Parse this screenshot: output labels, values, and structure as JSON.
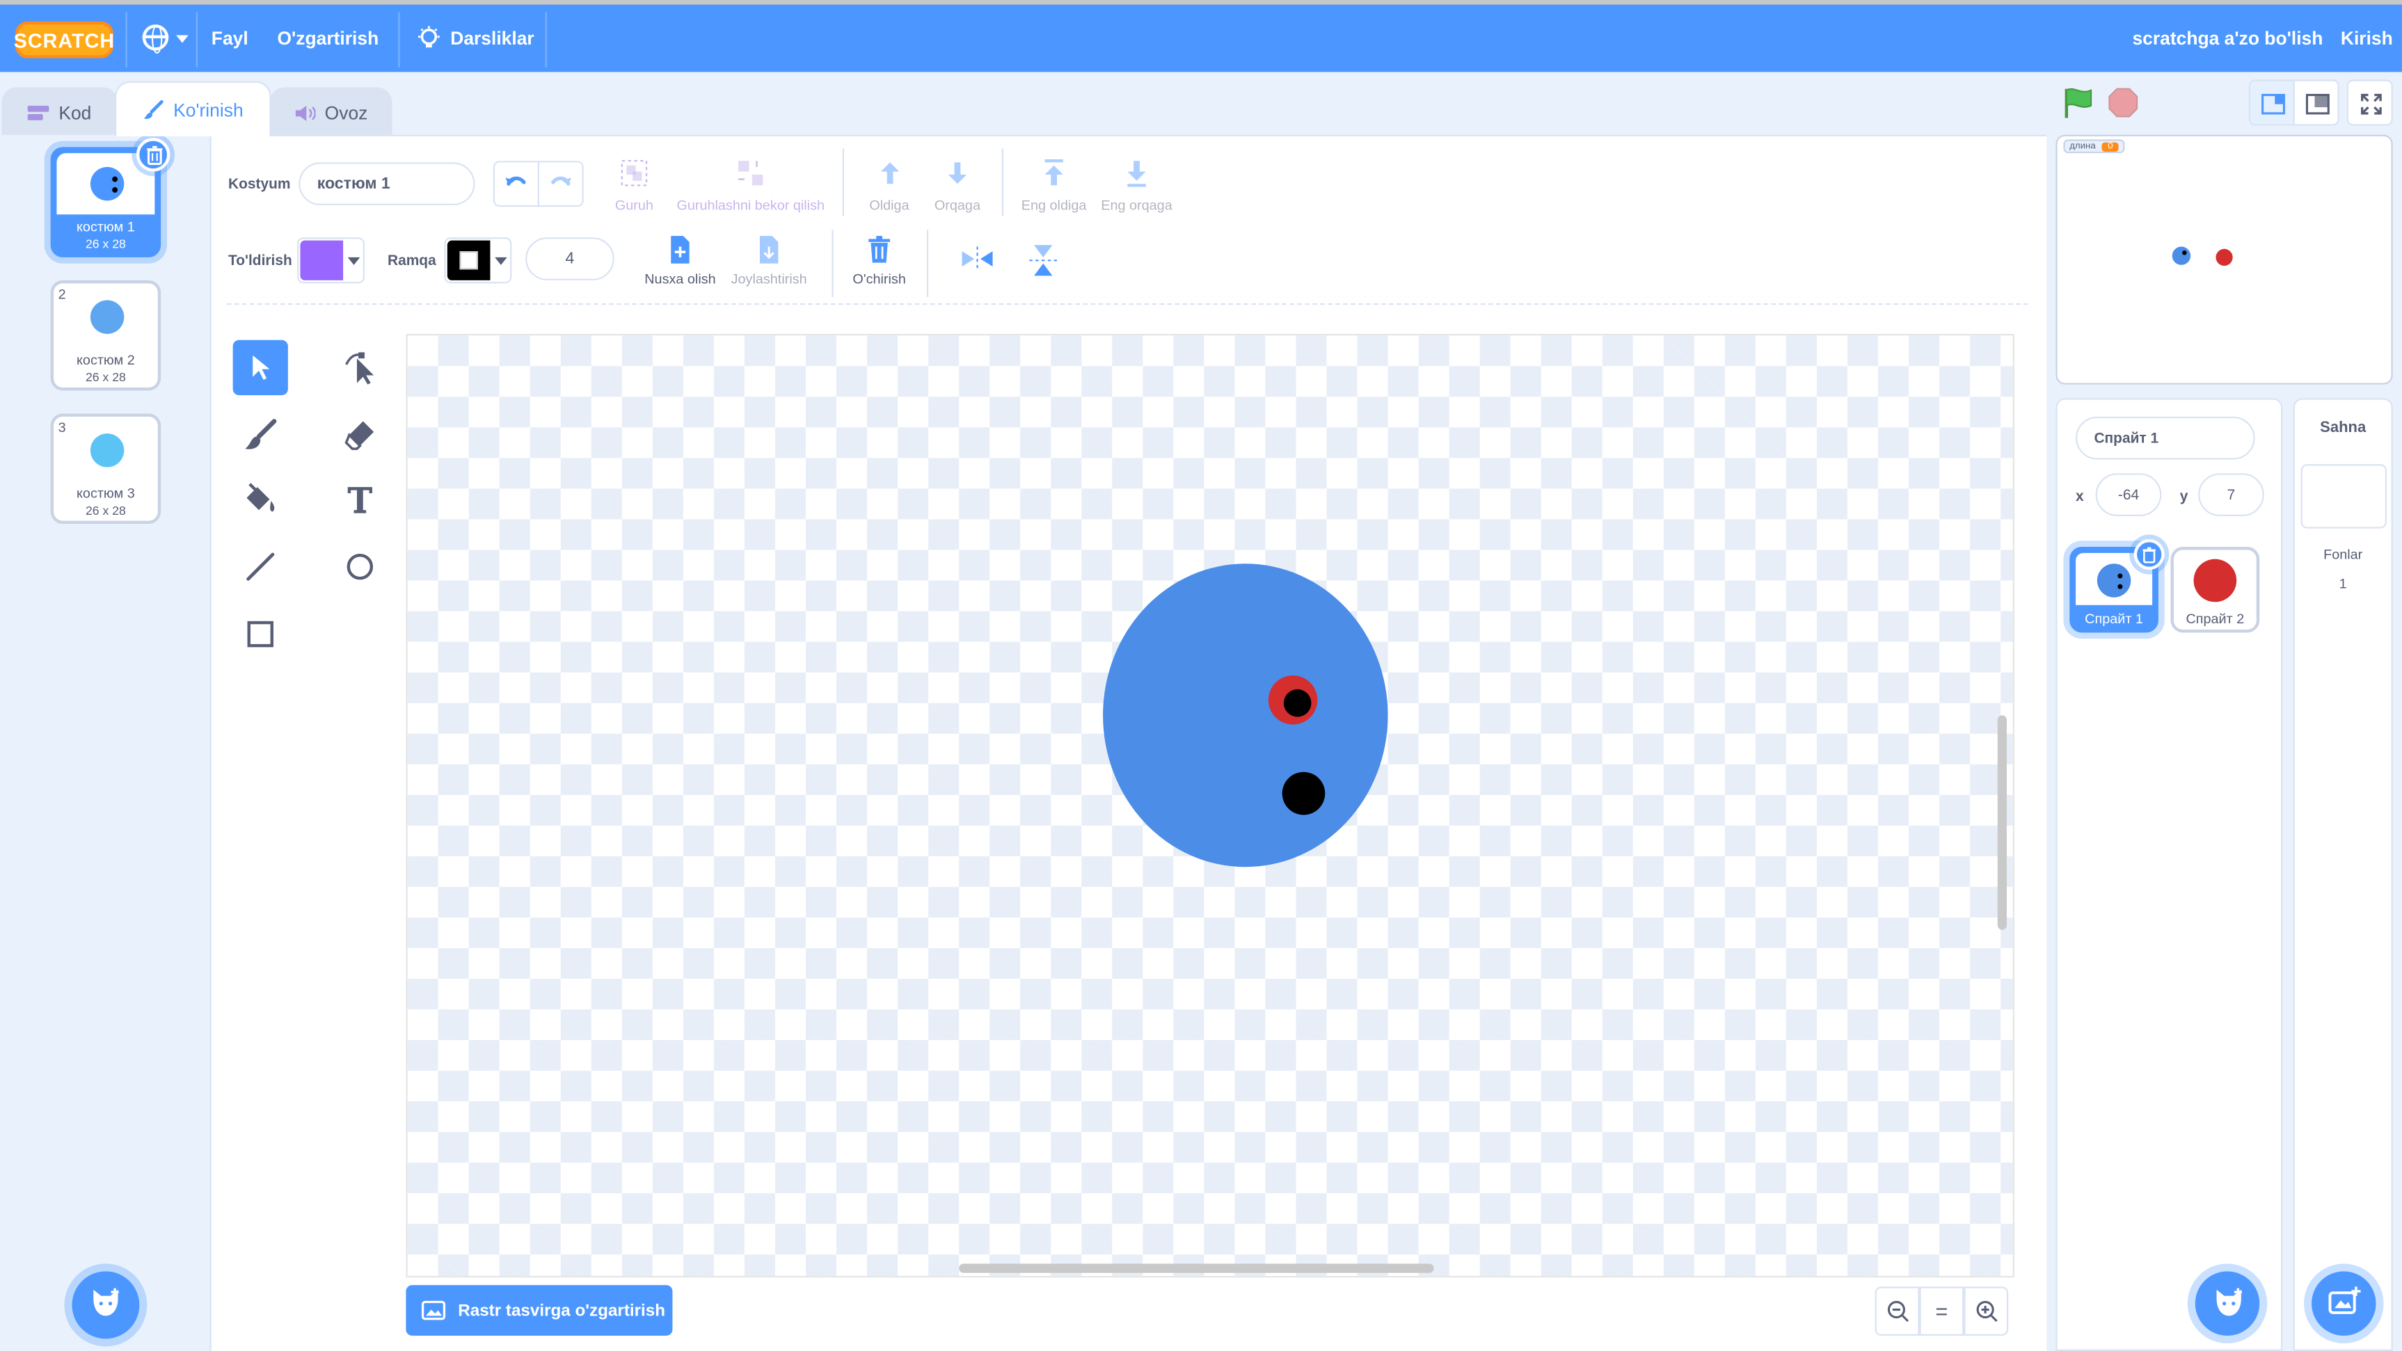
{
  "menu": {
    "logo": "SCRATCH",
    "file": "Fayl",
    "edit": "O'zgartirish",
    "tutorials": "Darsliklar",
    "join": "scratchga a'zo bo'lish",
    "signin": "Kirish"
  },
  "tabs": {
    "code": "Kod",
    "costumes": "Ko'rinish",
    "sounds": "Ovoz"
  },
  "costumes": [
    {
      "num": "1",
      "name": "костюм 1",
      "size": "26 x 28",
      "color": "#4c97ff"
    },
    {
      "num": "2",
      "name": "костюм 2",
      "size": "26 x 28",
      "color": "#5ea6f0"
    },
    {
      "num": "3",
      "name": "костюм 3",
      "size": "26 x 28",
      "color": "#5bc4f5"
    }
  ],
  "editor": {
    "costume_label": "Kostyum",
    "costume_name": "костюм 1",
    "group": "Guruh",
    "ungroup": "Guruhlashni bekor qilish",
    "forward": "Oldiga",
    "backward": "Orqaga",
    "front": "Eng oldiga",
    "back": "Eng orqaga",
    "fill_label": "To'ldirish",
    "outline_label": "Ramqa",
    "outline_width": "4",
    "copy": "Nusxa olish",
    "paste": "Joylashtirish",
    "delete": "O'chirish",
    "convert": "Rastr tasvirga o'zgartirish",
    "zoom_reset": "="
  },
  "colors": {
    "fill": "#9966ff",
    "outline": "#000000",
    "accent": "#4c97ff"
  },
  "sprite_info": {
    "name": "Спрайт 1",
    "x_label": "x",
    "x": "-64",
    "y_label": "y",
    "y": "7"
  },
  "sprites": [
    {
      "name": "Спрайт 1"
    },
    {
      "name": "Спрайт 2"
    }
  ],
  "stage": {
    "title": "Sahna",
    "backdrops_label": "Fonlar",
    "backdrops_count": "1",
    "variable_label": "длина",
    "variable_value": "0"
  }
}
